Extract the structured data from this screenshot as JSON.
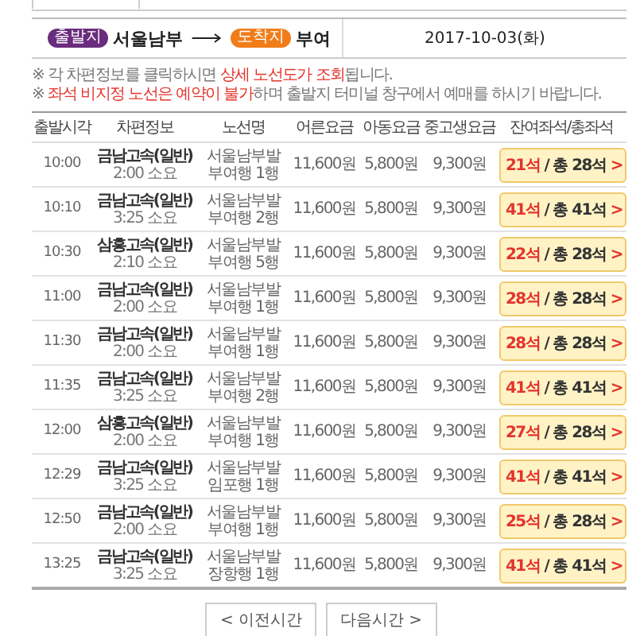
{
  "route": {
    "origin_badge": "출발지",
    "origin": "서울남부",
    "destination_badge": "도착지",
    "destination": "부여",
    "date": "2017-10-03(화)"
  },
  "notes": [
    {
      "mark": "※",
      "parts": [
        {
          "text": "각 차편정보를 클릭하시면 ",
          "highlight": false
        },
        {
          "text": "상세 노선도가 조회",
          "highlight": true
        },
        {
          "text": "됩니다.",
          "highlight": false
        }
      ]
    },
    {
      "mark": "※",
      "parts": [
        {
          "text": "좌석 비지정 노선은 예약이 불가",
          "highlight": true
        },
        {
          "text": "하며 출발지 터미널 창구에서 예매를 하시기 바랍니다.",
          "highlight": false
        }
      ]
    }
  ],
  "table": {
    "columns": [
      "출발시각",
      "차편정보",
      "노선명",
      "어른요금",
      "아동요금",
      "중고생요금",
      "잔여좌석/총좌석"
    ],
    "rows": [
      {
        "time": "10:00",
        "company": "금남고속(일반)",
        "duration": "2:00 소요",
        "route": "서울남부발 부여행 1행",
        "adult": "11,600원",
        "child": "5,800원",
        "student": "9,300원",
        "remaining": "21석",
        "total": "/ 총 28석",
        "arrow": ">"
      },
      {
        "time": "10:10",
        "company": "금남고속(일반)",
        "duration": "3:25 소요",
        "route": "서울남부발 부여행 2행",
        "adult": "11,600원",
        "child": "5,800원",
        "student": "9,300원",
        "remaining": "41석",
        "total": "/ 총 41석",
        "arrow": ">"
      },
      {
        "time": "10:30",
        "company": "삼흥고속(일반)",
        "duration": "2:10 소요",
        "route": "서울남부발 부여행 5행",
        "adult": "11,600원",
        "child": "5,800원",
        "student": "9,300원",
        "remaining": "22석",
        "total": "/ 총 28석",
        "arrow": ">"
      },
      {
        "time": "11:00",
        "company": "금남고속(일반)",
        "duration": "2:00 소요",
        "route": "서울남부발 부여행 1행",
        "adult": "11,600원",
        "child": "5,800원",
        "student": "9,300원",
        "remaining": "28석",
        "total": "/ 총 28석",
        "arrow": ">"
      },
      {
        "time": "11:30",
        "company": "금남고속(일반)",
        "duration": "2:00 소요",
        "route": "서울남부발 부여행 1행",
        "adult": "11,600원",
        "child": "5,800원",
        "student": "9,300원",
        "remaining": "28석",
        "total": "/ 총 28석",
        "arrow": ">"
      },
      {
        "time": "11:35",
        "company": "금남고속(일반)",
        "duration": "3:25 소요",
        "route": "서울남부발 부여행 2행",
        "adult": "11,600원",
        "child": "5,800원",
        "student": "9,300원",
        "remaining": "41석",
        "total": "/ 총 41석",
        "arrow": ">"
      },
      {
        "time": "12:00",
        "company": "삼흥고속(일반)",
        "duration": "2:00 소요",
        "route": "서울남부발 부여행 1행",
        "adult": "11,600원",
        "child": "5,800원",
        "student": "9,300원",
        "remaining": "27석",
        "total": "/ 총 28석",
        "arrow": ">"
      },
      {
        "time": "12:29",
        "company": "금남고속(일반)",
        "duration": "3:25 소요",
        "route": "서울남부발 임포행 1행",
        "adult": "11,600원",
        "child": "5,800원",
        "student": "9,300원",
        "remaining": "41석",
        "total": "/ 총 41석",
        "arrow": ">"
      },
      {
        "time": "12:50",
        "company": "금남고속(일반)",
        "duration": "2:00 소요",
        "route": "서울남부발 부여행 1행",
        "adult": "11,600원",
        "child": "5,800원",
        "student": "9,300원",
        "remaining": "25석",
        "total": "/ 총 28석",
        "arrow": ">"
      },
      {
        "time": "13:25",
        "company": "금남고속(일반)",
        "duration": "3:25 소요",
        "route": "서울남부발 장항행 1행",
        "adult": "11,600원",
        "child": "5,800원",
        "student": "9,300원",
        "remaining": "41석",
        "total": "/ 총 41석",
        "arrow": ">"
      }
    ]
  },
  "pager": [
    {
      "kind": "prev",
      "arrow": "<",
      "label": "이전시간"
    },
    {
      "kind": "next",
      "arrow": ">",
      "label": "다음시간"
    }
  ]
}
